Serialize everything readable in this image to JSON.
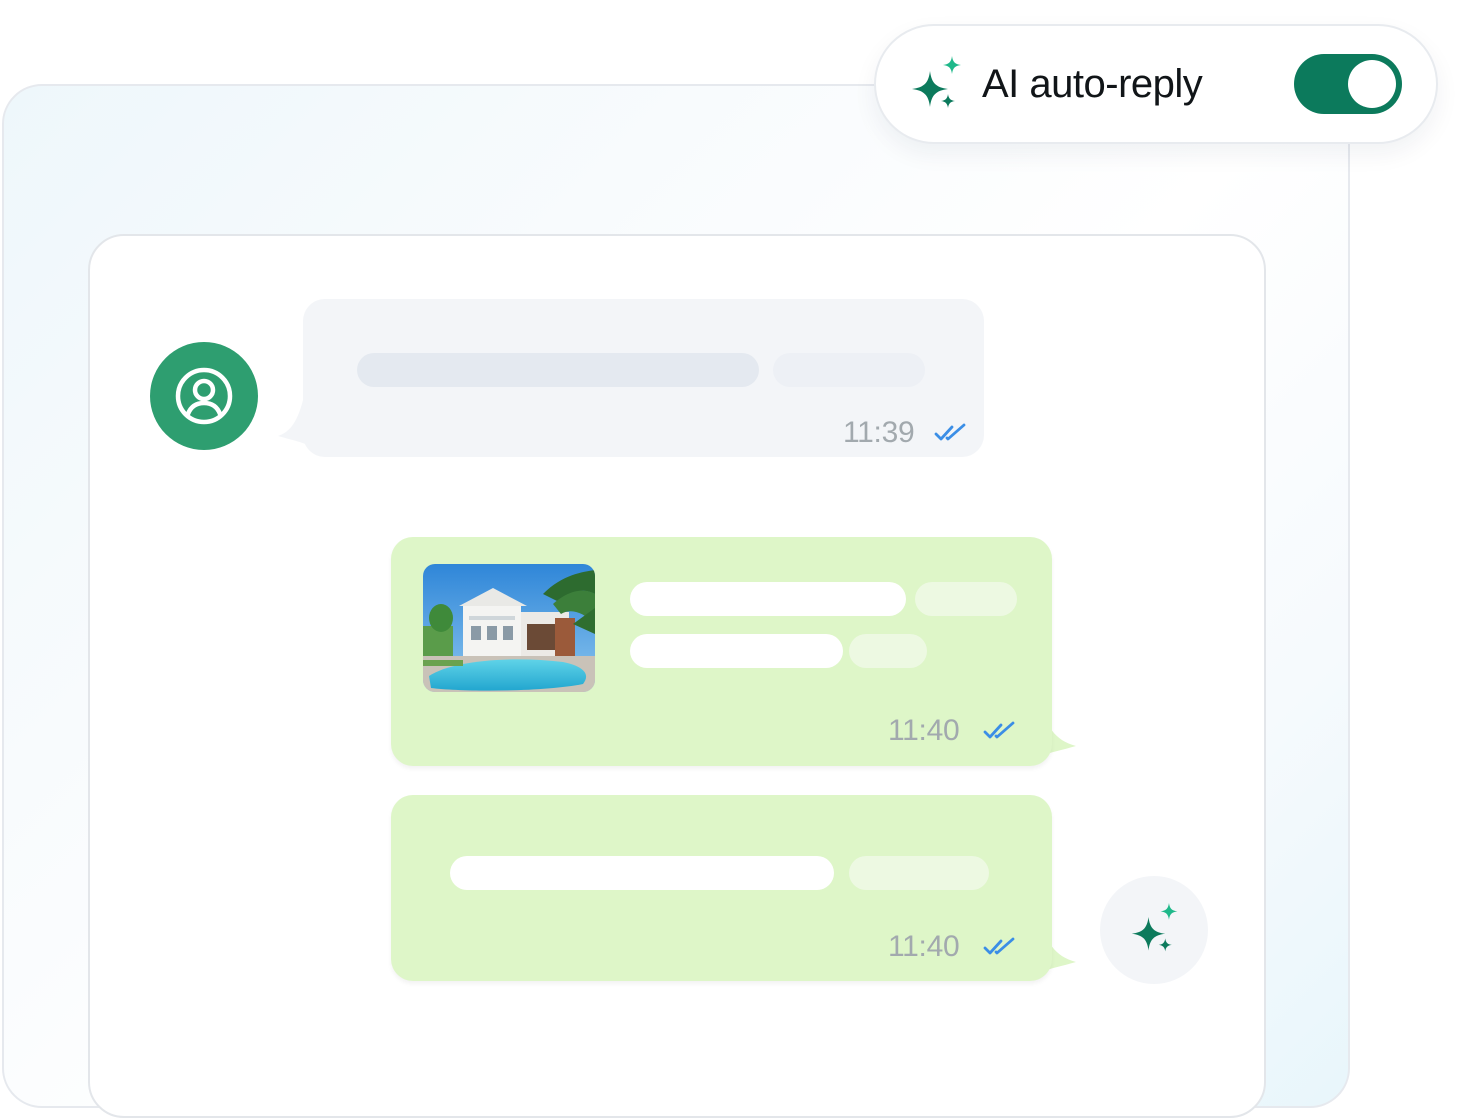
{
  "header": {
    "toggle_label": "AI auto-reply",
    "toggle_on": true,
    "icon": "sparkle-icon",
    "accent": "#0c7a5c"
  },
  "chat": {
    "messages": [
      {
        "direction": "incoming",
        "time": "11:39",
        "status": "read",
        "avatar_icon": "user-circle-icon"
      },
      {
        "direction": "outgoing",
        "time": "11:40",
        "status": "read",
        "attachment": "house-photo"
      },
      {
        "direction": "outgoing",
        "time": "11:40",
        "status": "read",
        "sender_icon": "sparkle-icon"
      }
    ]
  },
  "colors": {
    "incoming_bubble": "#f3f5f8",
    "outgoing_bubble": "#def6c8",
    "avatar": "#2e9e70",
    "read_ticks": "#3b8ee6"
  }
}
